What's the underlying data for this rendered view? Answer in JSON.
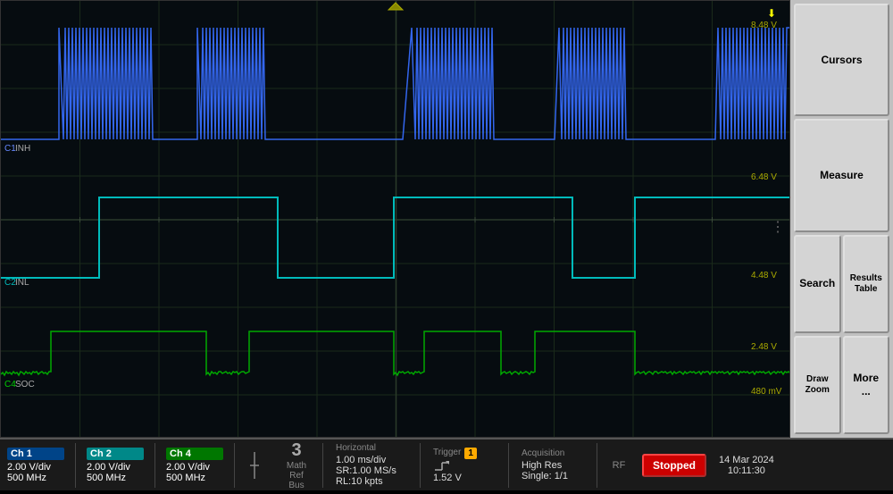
{
  "scope": {
    "display_width": 885,
    "display_height": 490,
    "background": "#0a0a1a",
    "grid_color": "#1a2a1a",
    "channels": {
      "ch1": {
        "label": "Ch 1",
        "color": "#3366ff",
        "volts_div": "2.00 V/div",
        "sample_rate": "500 MHz",
        "signal_label": "INH"
      },
      "ch2": {
        "label": "Ch 2",
        "color": "#00cccc",
        "volts_div": "2.00 V/div",
        "sample_rate": "500 MHz",
        "signal_label": "INL"
      },
      "ch4": {
        "label": "Ch 4",
        "color": "#00cc00",
        "volts_div": "2.00 V/div",
        "sample_rate": "500 MHz",
        "signal_label": "SOC"
      }
    }
  },
  "right_panel": {
    "buttons": [
      {
        "id": "cursors",
        "label": "Cursors"
      },
      {
        "id": "measure",
        "label": "Measure"
      },
      {
        "id": "search",
        "label": "Search"
      },
      {
        "id": "results-table",
        "label": "Results\nTable"
      },
      {
        "id": "draw-zoom",
        "label": "Draw\nZoom"
      },
      {
        "id": "more",
        "label": "More ..."
      }
    ]
  },
  "bottom_bar": {
    "ch1": {
      "label": "Ch 1",
      "volts_div": "2.00 V/div",
      "sample_rate": "500 MHz"
    },
    "ch2": {
      "label": "Ch 2",
      "volts_div": "2.00 V/div",
      "sample_rate": "500 MHz"
    },
    "ch4": {
      "label": "Ch 4",
      "volts_div": "2.00 V/div",
      "sample_rate": "500 MHz"
    },
    "number": "3",
    "math_ref_bus": "Math\nRef\nBus",
    "horizontal": {
      "title": "Horizontal",
      "time_div": "1.00 ms/div",
      "sample_rate": "SR:1.00 MS/s",
      "record_length": "RL:10 kpts"
    },
    "trigger": {
      "title": "Trigger",
      "channel": "1",
      "voltage": "1.52 V"
    },
    "acquisition": {
      "title": "Acquisition",
      "mode": "High Res",
      "type": "Single: 1/1"
    },
    "rf": "RF",
    "stopped": "Stopped",
    "date": "14 Mar 2024",
    "time": "10:11:30"
  },
  "voltage_labels": [
    "8.48 V",
    "6.48 V",
    "4.48 V",
    "2.48 V",
    "480 mV"
  ]
}
